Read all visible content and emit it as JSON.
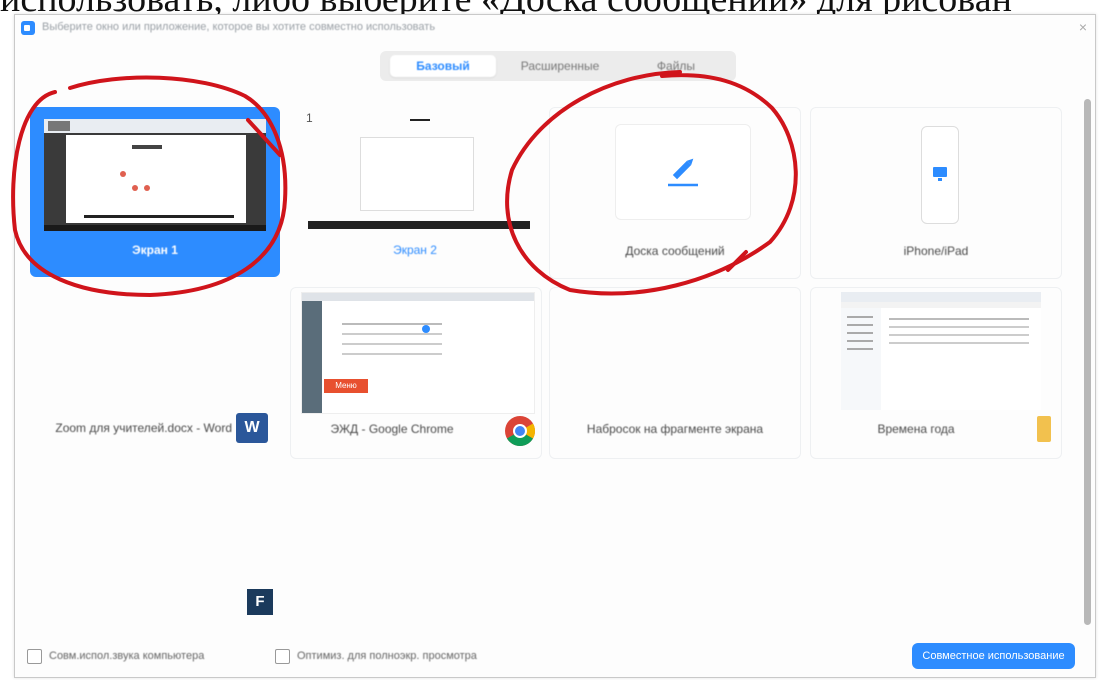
{
  "document_text": "использовать, либо выберите «Доска сообщений» для рисован",
  "dialog": {
    "title": "Выберите окно или приложение, которое вы хотите совместно использовать",
    "close": "×"
  },
  "tabs": [
    {
      "label": "Базовый",
      "active": true
    },
    {
      "label": "Расширенные",
      "active": false
    },
    {
      "label": "Файлы",
      "active": false
    }
  ],
  "tiles": [
    {
      "label": "Экран 1",
      "selected": true
    },
    {
      "label": "Экран 2",
      "badge": "1"
    },
    {
      "label": "Доска сообщений"
    },
    {
      "label": "iPhone/iPad"
    },
    {
      "label": "Zoom для учителей.docx - Word",
      "app_icon": "word-icon",
      "app_letter": "W"
    },
    {
      "label": "ЭЖД - Google Chrome",
      "app_icon": "chrome-icon"
    },
    {
      "label": "Набросок на фрагменте экрана"
    },
    {
      "label": "Времена года",
      "app_icon": "folder-icon"
    },
    {
      "label": "",
      "app_icon": "fsecure-icon",
      "app_letter": "F"
    }
  ],
  "thumb_text": {
    "red_button": "Меню"
  },
  "footer": {
    "checkbox_sound": "Совм.испол.звука компьютера",
    "checkbox_optimize": "Оптимиз. для полноэкр. просмотра",
    "share_button": "Совместное использование"
  },
  "colors": {
    "accent": "#2D8CFF",
    "annotation": "#D0141B"
  }
}
